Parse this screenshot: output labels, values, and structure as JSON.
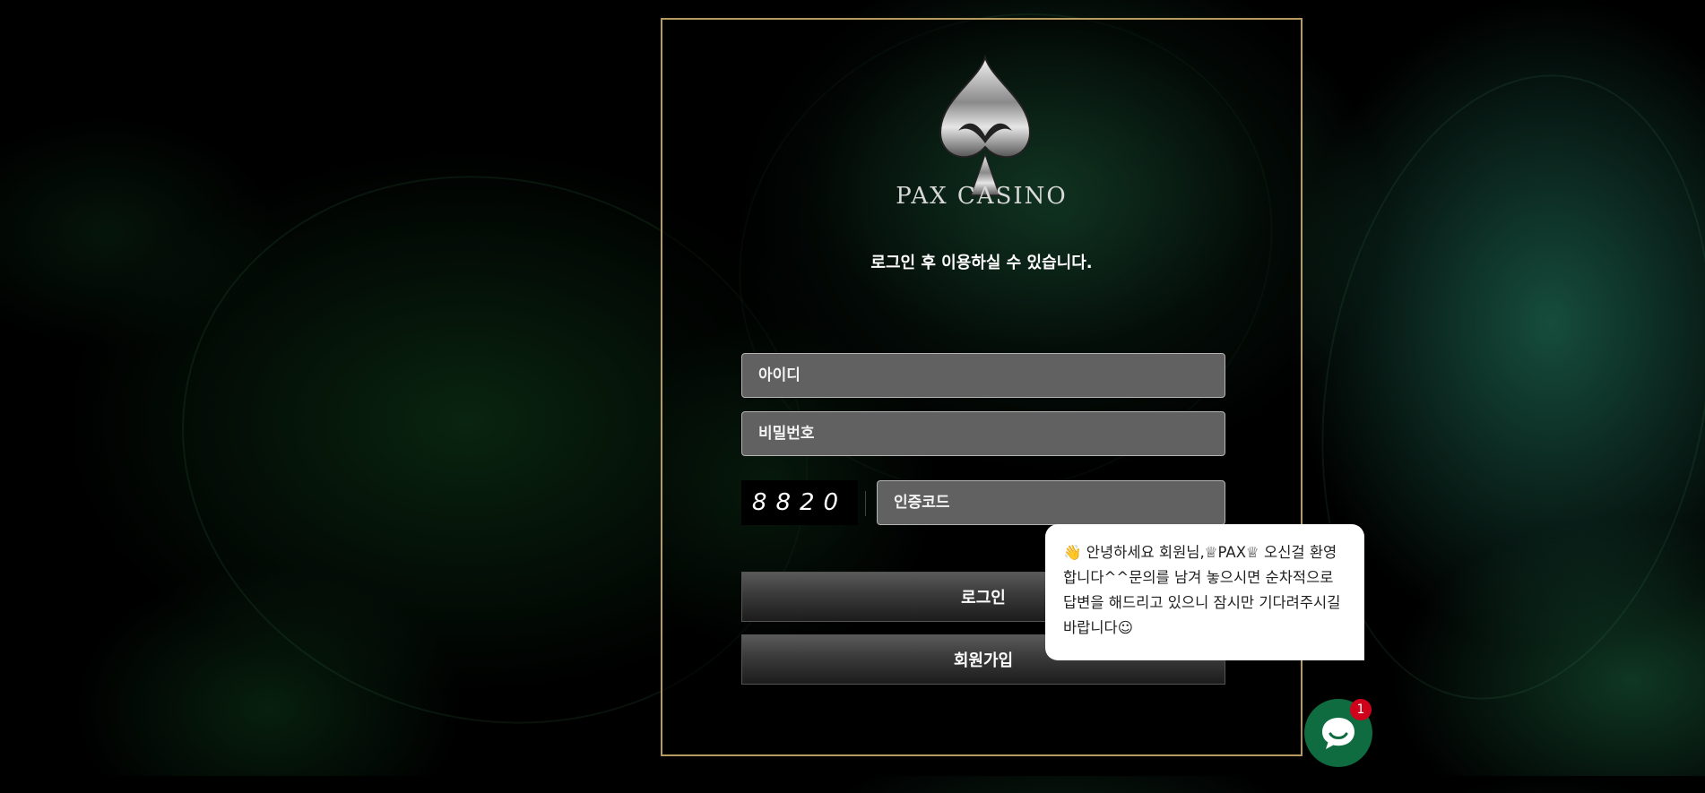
{
  "brand": {
    "name": "PAX CASINO",
    "logo_icon": "spade-logo-icon"
  },
  "login": {
    "notice": "로그인 후 이용하실 수 있습니다.",
    "id_placeholder": "아이디",
    "password_placeholder": "비밀번호",
    "captcha_code": "8820",
    "captcha_placeholder": "인증코드",
    "login_label": "로그인",
    "signup_label": "회원가입"
  },
  "chat": {
    "message": "👋 안녕하세요 회원님,♕PAX♕ 오신걸 환영합니다^^문의를 남겨 놓으시면 순차적으로 답변을 해드리고 있으니 잠시만 기다려주시길 바랍니다☺",
    "unread_count": "1",
    "button_icon": "chat-icon"
  },
  "colors": {
    "panel_border": "#b79a5e",
    "field_bg": "#616161",
    "chat_button": "#0f6b40",
    "badge": "#d0021b"
  }
}
